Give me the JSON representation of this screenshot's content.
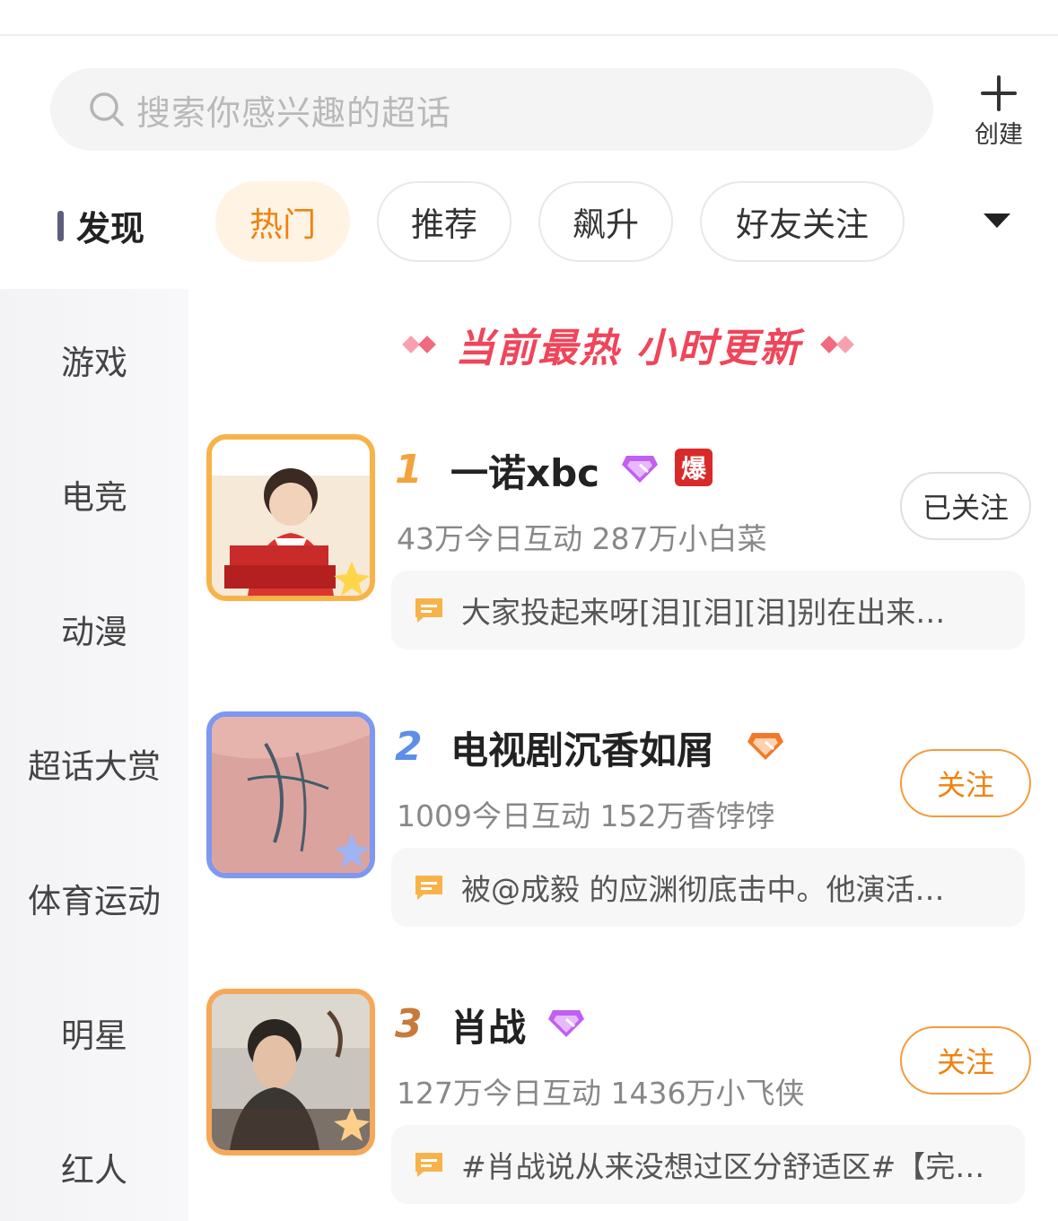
{
  "search": {
    "placeholder": "搜索你感兴趣的超话"
  },
  "create": {
    "label": "创建"
  },
  "section": {
    "label": "发现"
  },
  "tabs": [
    {
      "label": "热门",
      "active": true
    },
    {
      "label": "推荐",
      "active": false
    },
    {
      "label": "飙升",
      "active": false
    },
    {
      "label": "好友关注",
      "active": false
    }
  ],
  "sidebar": {
    "items": [
      "游戏",
      "电竞",
      "动漫",
      "超话大赏",
      "体育运动",
      "明星",
      "红人"
    ]
  },
  "banner": {
    "text": "当前最热 小时更新"
  },
  "list": [
    {
      "rank": "1",
      "name": "一诺xbc",
      "badge_hot": "爆",
      "stats": "43万今日互动 287万小白菜",
      "follow": "已关注",
      "quote": "大家投起来呀[泪][泪][泪]别在出来…",
      "rank_color": "#f4a23a",
      "gem_color": "#c060f0"
    },
    {
      "rank": "2",
      "name": "电视剧沉香如屑",
      "stats": "1009今日互动 152万香饽饽",
      "follow": "关注",
      "quote": "被@成毅 的应渊彻底击中。他演活…",
      "rank_color": "#5b8fe8",
      "gem_color": "#f07a2a"
    },
    {
      "rank": "3",
      "name": "肖战",
      "stats": "127万今日互动 1436万小飞侠",
      "follow": "关注",
      "quote": "#肖战说从来没想过区分舒适区#【完…",
      "rank_color": "#c77a3a",
      "gem_color": "#c060f0"
    }
  ]
}
